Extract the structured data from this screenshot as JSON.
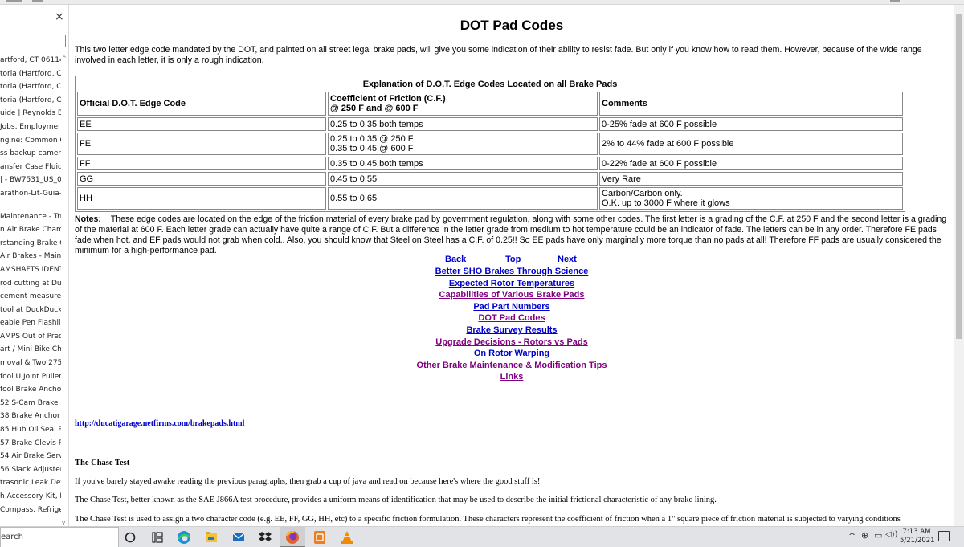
{
  "sidebar": {
    "close_glyph": "×",
    "items": [
      "artford, CT 06114) | ^",
      "toria (Hartford, CT",
      "toria (Hartford, CT",
      "toria (Hartford, CT",
      "uide | Reynolds Bra",
      "Jobs, Employment",
      "ngine: Common Ca",
      "ss backup camera",
      "ansfer Case Fluid ..",
      "| - BW7531_US_002",
      "arathon-Lit-Guia-de",
      "Maintenance - Tru.",
      "n Air Brake Chamb",
      "rstanding Brake Ch",
      "Air Brakes - Maint",
      "AMSHAFTS IDENTIF",
      "rod cutting at Duc",
      "cement measurem.",
      "tool at DuckDuckG",
      "eable Pen Flashligh",
      "AMPS Out of Preda",
      "art / Mini Bike Char",
      "moval & Two 275 g",
      "fool U Joint Pullers",
      "fool Brake Anchor P",
      "52 S-Cam Brake Sl",
      "38 Brake Anchor P",
      "85 Hub Oil Seal Re",
      "57 Brake Clevis Pin",
      "54 Air Brake Servic",
      "56 Slack Adjuster ,",
      "trasonic Leak Dete",
      "h Accessory Kit, En",
      "Compass, Refriger"
    ]
  },
  "page": {
    "title": "DOT Pad Codes",
    "intro": "This two letter edge code mandated by the DOT, and painted on all street legal brake pads, will give you some indication of their ability to resist fade. But only if you know how to read them. However, because of the wide range involved in each letter, it is only a rough indication."
  },
  "table": {
    "caption": "Explanation of D.O.T. Edge Codes Located on all Brake Pads",
    "headers": {
      "code": "Official D.O.T. Edge Code",
      "cof_line1": "Coefficient of Friction (C.F.)",
      "cof_line2": "@ 250 F and @ 600 F",
      "comments": "Comments"
    },
    "rows": [
      {
        "code": "EE",
        "cof1": "0.25 to 0.35 both temps",
        "cof2": "",
        "comment1": "0-25% fade at 600 F possible",
        "comment2": ""
      },
      {
        "code": "FE",
        "cof1": "0.25 to 0.35 @ 250 F",
        "cof2": "0.35 to 0.45 @ 600 F",
        "comment1": "2% to 44% fade at 600 F possible",
        "comment2": ""
      },
      {
        "code": "FF",
        "cof1": "0.35 to 0.45 both temps",
        "cof2": "",
        "comment1": "0-22% fade at 600 F possible",
        "comment2": ""
      },
      {
        "code": "GG",
        "cof1": "0.45 to 0.55",
        "cof2": "",
        "comment1": "Very Rare",
        "comment2": ""
      },
      {
        "code": "HH",
        "cof1": "0.55 to 0.65",
        "cof2": "",
        "comment1": "Carbon/Carbon only.",
        "comment2": "O.K. up to 3000 F where it glows"
      }
    ]
  },
  "notes": {
    "label": "Notes:",
    "text": "These edge codes are located on the edge of the friction material of every brake pad by government regulation, along with some other codes. The first letter is a grading of the C.F. at 250 F and the second letter is a grading of the material at 600 F. Each letter grade can actually have quite a range of C.F. But a difference in the letter grade from medium to hot temperature could be an indicator of fade. The letters can be in any order. Therefore FE pads fade when hot, and EF pads would not grab when cold.. Also, you should know that Steel on Steel has a C.F. of 0.25!! So EE pads have only marginally more torque than no pads at all! Therefore FF pads are usually considered the minimum for a high-performance pad."
  },
  "nav": {
    "back": "Back",
    "top": "Top",
    "next": "Next",
    "links": [
      {
        "label": "Better SHO Brakes Through Science",
        "visited": false
      },
      {
        "label": "Expected Rotor Temperatures",
        "visited": false
      },
      {
        "label": "Capabilities of Various Brake Pads",
        "visited": true
      },
      {
        "label": "Pad Part Numbers",
        "visited": false
      },
      {
        "label": "DOT Pad Codes",
        "visited": true
      },
      {
        "label": "Brake Survey Results",
        "visited": false
      },
      {
        "label": "Upgrade Decisions - Rotors vs Pads",
        "visited": true
      },
      {
        "label": "On Rotor Warping",
        "visited": false
      },
      {
        "label": "Other Brake Maintenance & Modification Tips",
        "visited": true
      },
      {
        "label": "Links",
        "visited": true
      }
    ]
  },
  "source_url": "http://ducatigarage.netfirms.com/brakepads.html",
  "chase": {
    "heading": "The Chase Test",
    "p1": "If you've barely stayed awake reading the previous paragraphs, then grab a cup of java and read on because here's where the good stuff is!",
    "p2": "The Chase Test, better known as the SAE J866A test procedure, provides a uniform means of identification that may be used to describe the initial frictional characteristic of any brake lining.",
    "p3": "The Chase Test is used to assign a two character code (e.g. EE, FF, GG, HH, etc) to a specific friction formulation. These characters represent the coefficient of friction when a 1\" square piece of friction material is subjected to varying conditions"
  },
  "taskbar": {
    "search_text": "earch",
    "tray_glyphs": "^  ⊕  ▭  ◁))",
    "time": "7:13 AM",
    "date": "5/21/2021",
    "colors": {
      "edge": "#1e90d8",
      "explorer": "#f2c23a",
      "mail": "#1a6fc4",
      "dropbox": "#0b62d6",
      "firefox": "#e8622a",
      "app": "#f07d1c",
      "vlc": "#f08a00"
    }
  }
}
